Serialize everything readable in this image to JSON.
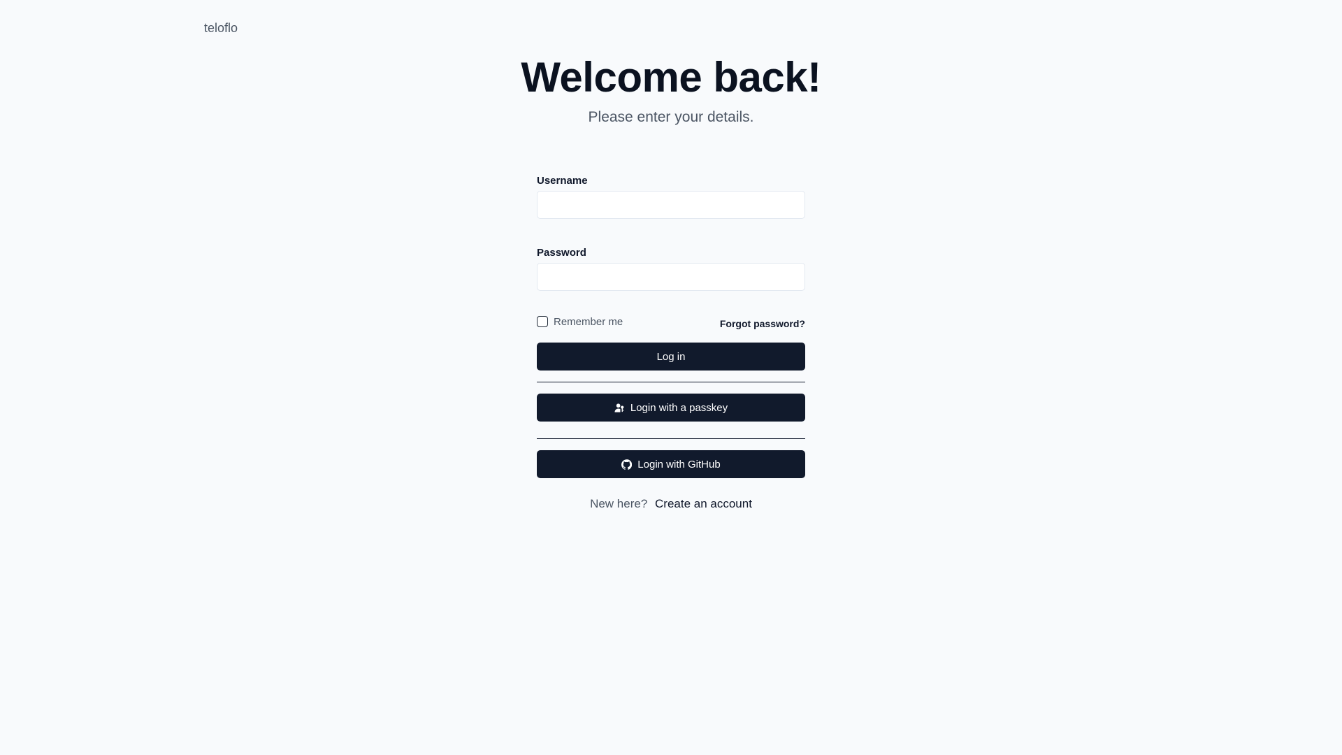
{
  "brand": "teloflo",
  "header": {
    "title": "Welcome back!",
    "subtitle": "Please enter your details."
  },
  "form": {
    "username_label": "Username",
    "username_value": "",
    "password_label": "Password",
    "password_value": "",
    "remember_label": "Remember me",
    "remember_checked": false,
    "forgot_label": "Forgot password?",
    "login_label": "Log in",
    "passkey_label": "Login with a passkey",
    "passkey_icon": "user-key-icon",
    "github_label": "Login with GitHub",
    "github_icon": "github-icon"
  },
  "signup": {
    "prompt": "New here?",
    "link_label": "Create an account"
  },
  "colors": {
    "background": "#f8fafc",
    "button": "#111a2c",
    "text": "#0f172a",
    "muted": "#4b5563"
  }
}
